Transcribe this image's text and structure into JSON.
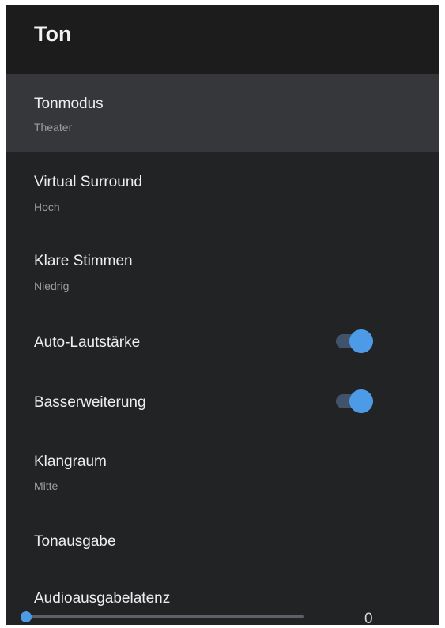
{
  "header": {
    "title": "Ton"
  },
  "items": [
    {
      "title": "Tonmodus",
      "value": "Theater"
    },
    {
      "title": "Virtual Surround",
      "value": "Hoch"
    },
    {
      "title": "Klare Stimmen",
      "value": "Niedrig"
    },
    {
      "title": "Auto-Lautstärke",
      "toggle": true
    },
    {
      "title": "Basserweiterung",
      "toggle": true
    },
    {
      "title": "Klangraum",
      "value": "Mitte"
    },
    {
      "title": "Tonausgabe"
    },
    {
      "title": "Audioausgabelatenz",
      "slider_value": "0",
      "slider_fraction": 0
    }
  ],
  "colors": {
    "panel": "#222325",
    "header": "#1c1c1d",
    "selected": "#36373a",
    "accent": "#4d9be6"
  }
}
